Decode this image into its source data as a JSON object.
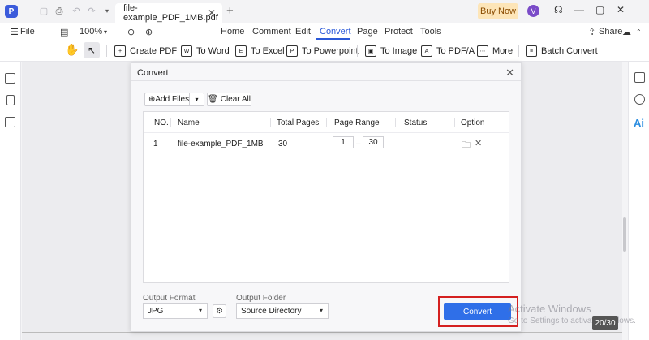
{
  "titlebar": {
    "tab_title": "file-example_PDF_1MB.pdf",
    "buy_now": "Buy Now",
    "avatar_letter": "V"
  },
  "menubar": {
    "file": "File",
    "zoom": "100%",
    "tabs": [
      "Home",
      "Comment",
      "Edit",
      "Convert",
      "Page",
      "Protect",
      "Tools"
    ],
    "active_tab": "Convert",
    "share": "Share"
  },
  "toolbar": {
    "create_pdf": "Create PDF",
    "to_word": "To Word",
    "to_excel": "To Excel",
    "to_powerpoint": "To Powerpoint",
    "to_image": "To Image",
    "to_pdfa": "To PDF/A",
    "more": "More",
    "batch_convert": "Batch Convert"
  },
  "dialog": {
    "title": "Convert",
    "add_files": "Add Files",
    "clear_all": "Clear All",
    "columns": [
      "NO.",
      "Name",
      "Total Pages",
      "Page Range",
      "Status",
      "Option"
    ],
    "rows": [
      {
        "no": "1",
        "name": "file-example_PDF_1MB",
        "total_pages": "30",
        "range_from": "1",
        "range_to": "30",
        "status": ""
      }
    ],
    "output_format_label": "Output Format",
    "output_format_value": "JPG",
    "output_folder_label": "Output Folder",
    "output_folder_value": "Source Directory",
    "convert_button": "Convert"
  },
  "watermark": {
    "line1": "Activate Windows",
    "line2": "Go to Settings to activate Windows."
  },
  "page_counter": "20/30",
  "icons": {
    "ai": "Ai"
  }
}
